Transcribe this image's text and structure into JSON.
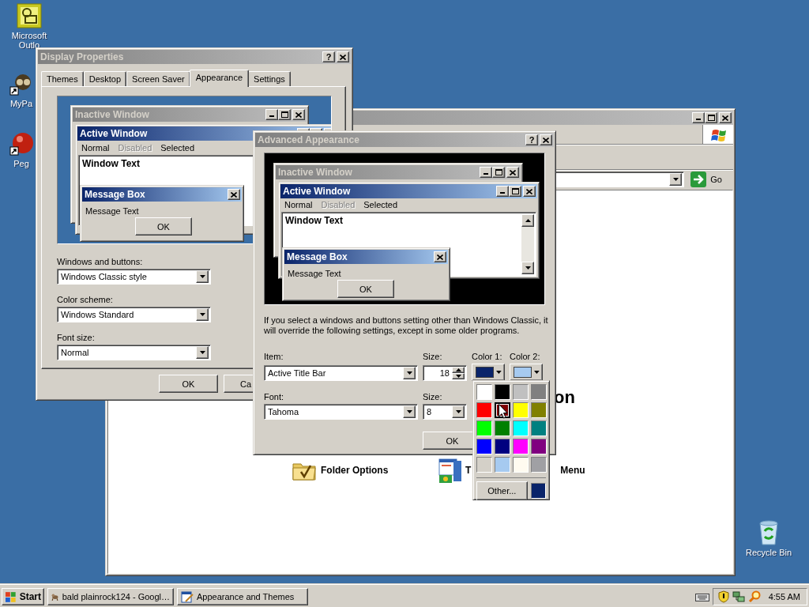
{
  "desktop_icons": [
    {
      "kind": "mail",
      "label": "Microsoft Outlo"
    },
    {
      "kind": "program",
      "label": "MyPa"
    },
    {
      "kind": "ball",
      "label": "Peg"
    },
    {
      "kind": "recycle",
      "label": "Recycle Bin"
    }
  ],
  "background_window": {
    "address_button": "Go",
    "heading_fragment": "on",
    "tasks": [
      {
        "kind": "folder",
        "label": "Folder Options"
      },
      {
        "kind": "taskbar",
        "label_start": "T",
        "label_end": "Menu"
      }
    ]
  },
  "display_properties": {
    "title": "Display Properties",
    "help_glyph": "?",
    "tabs": [
      {
        "label": "Themes",
        "selected": false
      },
      {
        "label": "Desktop",
        "selected": false
      },
      {
        "label": "Screen Saver",
        "selected": false
      },
      {
        "label": "Appearance",
        "selected": true
      },
      {
        "label": "Settings",
        "selected": false
      }
    ],
    "preview": {
      "inactive_title": "Inactive Window",
      "active_title": "Active Window",
      "menu_items": [
        {
          "label": "Normal",
          "disabled": false
        },
        {
          "label": "Disabled",
          "disabled": true
        },
        {
          "label": "Selected",
          "disabled": false
        }
      ],
      "window_text": "Window Text",
      "message_title": "Message Box",
      "message_text": "Message Text",
      "message_button": "OK"
    },
    "fields": [
      {
        "label": "Windows and buttons:",
        "value": "Windows Classic style"
      },
      {
        "label": "Color scheme:",
        "value": "Windows Standard"
      },
      {
        "label": "Font size:",
        "value": "Normal"
      }
    ],
    "buttons": [
      "OK",
      "Ca"
    ]
  },
  "advanced_appearance": {
    "title": "Advanced Appearance",
    "help_glyph": "?",
    "preview": {
      "inactive_title": "Inactive Window",
      "active_title": "Active Window",
      "menu_items": [
        {
          "label": "Normal",
          "disabled": false
        },
        {
          "label": "Disabled",
          "disabled": true
        },
        {
          "label": "Selected",
          "disabled": false
        }
      ],
      "window_text": "Window Text",
      "message_title": "Message Box",
      "message_text": "Message Text",
      "message_button": "OK"
    },
    "note": "If you select a windows and buttons setting other than Windows Classic, it will override the following settings, except in some older programs.",
    "item": {
      "label": "Item:",
      "value": "Active Title Bar"
    },
    "item_size": {
      "label": "Size:",
      "value": "18"
    },
    "color_1": {
      "label": "Color 1:",
      "color": "#0a246a"
    },
    "color_2": {
      "label": "Color 2:",
      "color": "#a6caf0"
    },
    "font": {
      "label": "Font:",
      "value": "Tahoma"
    },
    "font_size": {
      "label": "Size:",
      "value": "8"
    },
    "buttons": [
      "OK"
    ]
  },
  "color_palette": {
    "colors": [
      {
        "color": "#ffffff",
        "selected": false
      },
      {
        "color": "#000000",
        "selected": false
      },
      {
        "color": "#c0c0c0",
        "selected": false
      },
      {
        "color": "#808080",
        "selected": false
      },
      {
        "color": "#ff0000",
        "selected": false
      },
      {
        "color": "#800000",
        "selected": true
      },
      {
        "color": "#ffff00",
        "selected": false
      },
      {
        "color": "#808000",
        "selected": false
      },
      {
        "color": "#00ff00",
        "selected": false
      },
      {
        "color": "#008000",
        "selected": false
      },
      {
        "color": "#00ffff",
        "selected": false
      },
      {
        "color": "#008080",
        "selected": false
      },
      {
        "color": "#0000ff",
        "selected": false
      },
      {
        "color": "#000080",
        "selected": false
      },
      {
        "color": "#ff00ff",
        "selected": false
      },
      {
        "color": "#800080",
        "selected": false
      },
      {
        "color": "#d4d0c8",
        "selected": false
      },
      {
        "color": "#a6caf0",
        "selected": false
      },
      {
        "color": "#fffbf0",
        "selected": false
      },
      {
        "color": "#a0a0a4",
        "selected": false
      }
    ],
    "other_button": "Other...",
    "custom_swatch": {
      "color": "#0a246a"
    }
  },
  "taskbar": {
    "start": "Start",
    "tasks": [
      {
        "kind": "browser",
        "label": "bald plainrock124 - Googl…"
      },
      {
        "kind": "settings",
        "label": "Appearance and Themes"
      }
    ],
    "clock": "4:55 AM"
  }
}
